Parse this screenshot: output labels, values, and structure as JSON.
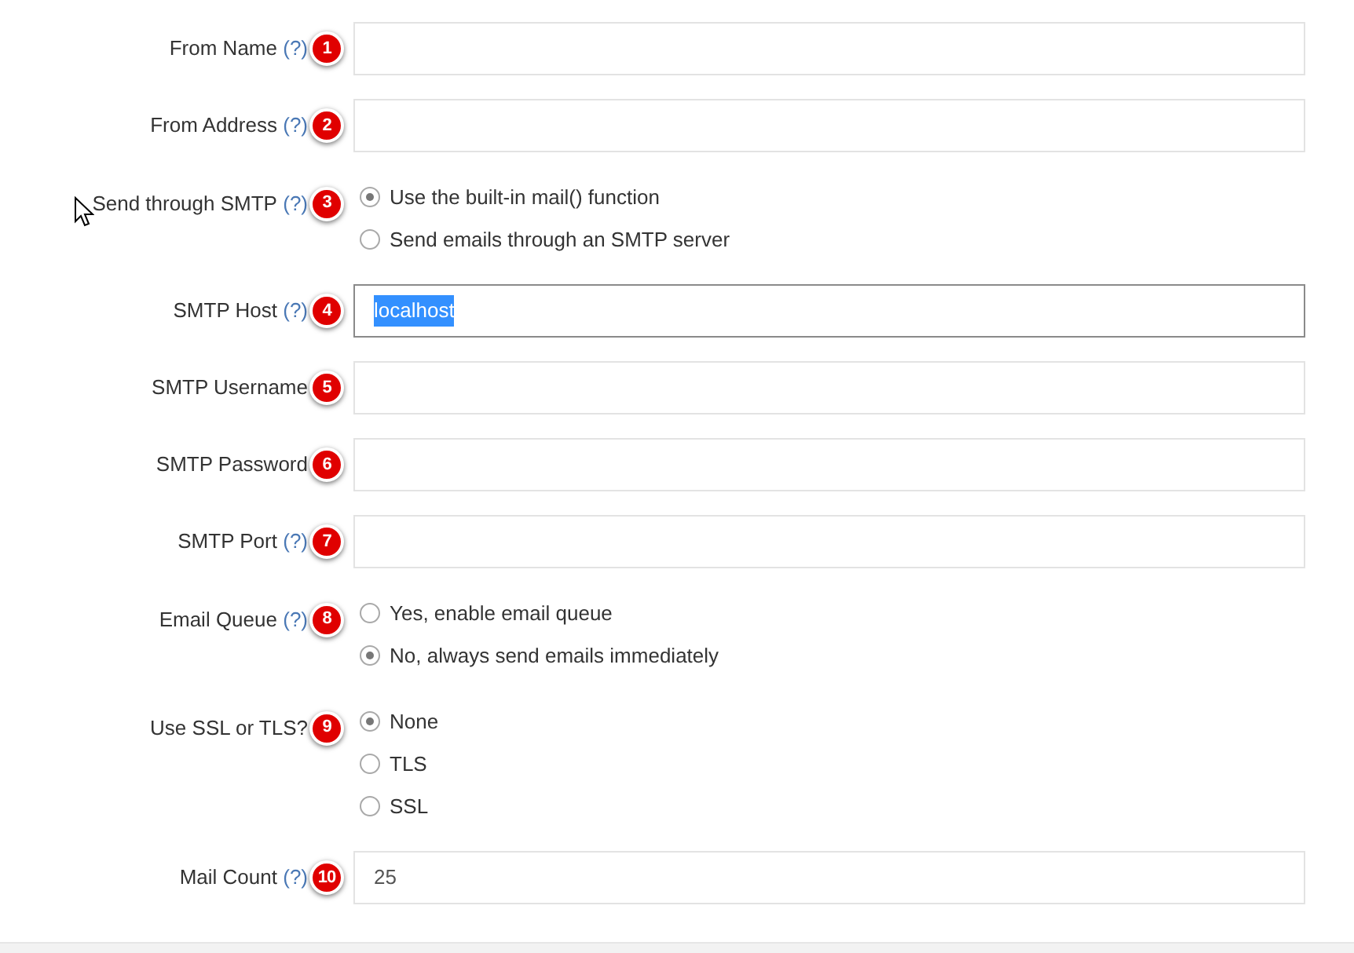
{
  "fields": [
    {
      "kind": "text",
      "label": "From Name",
      "help": "(?)",
      "badge": "1",
      "focused": false
    },
    {
      "kind": "text",
      "label": "From Address",
      "help": "(?)",
      "badge": "2",
      "focused": false
    },
    {
      "kind": "radio",
      "label": "Send through SMTP",
      "help": "(?)",
      "badge": "3",
      "options": [
        {
          "label": "Use the built-in mail() function",
          "selected": true
        },
        {
          "label": "Send emails through an SMTP server",
          "selected": false
        }
      ]
    },
    {
      "kind": "text",
      "label": "SMTP Host",
      "help": "(?)",
      "badge": "4",
      "value": "localhost",
      "focused": true
    },
    {
      "kind": "text",
      "label": "SMTP Username",
      "badge": "5",
      "focused": false
    },
    {
      "kind": "text",
      "label": "SMTP Password",
      "badge": "6",
      "focused": false
    },
    {
      "kind": "text",
      "label": "SMTP Port",
      "help": "(?)",
      "badge": "7",
      "focused": false
    },
    {
      "kind": "radio",
      "label": "Email Queue",
      "help": "(?)",
      "badge": "8",
      "options": [
        {
          "label": "Yes, enable email queue",
          "selected": false
        },
        {
          "label": "No, always send emails immediately",
          "selected": true
        }
      ]
    },
    {
      "kind": "radio",
      "label": "Use SSL or TLS?",
      "badge": "9",
      "options": [
        {
          "label": "None",
          "selected": true
        },
        {
          "label": "TLS",
          "selected": false
        },
        {
          "label": "SSL",
          "selected": false
        }
      ]
    },
    {
      "kind": "text",
      "label": "Mail Count",
      "help": "(?)",
      "badge": "10",
      "value": "25",
      "focused": false
    }
  ]
}
